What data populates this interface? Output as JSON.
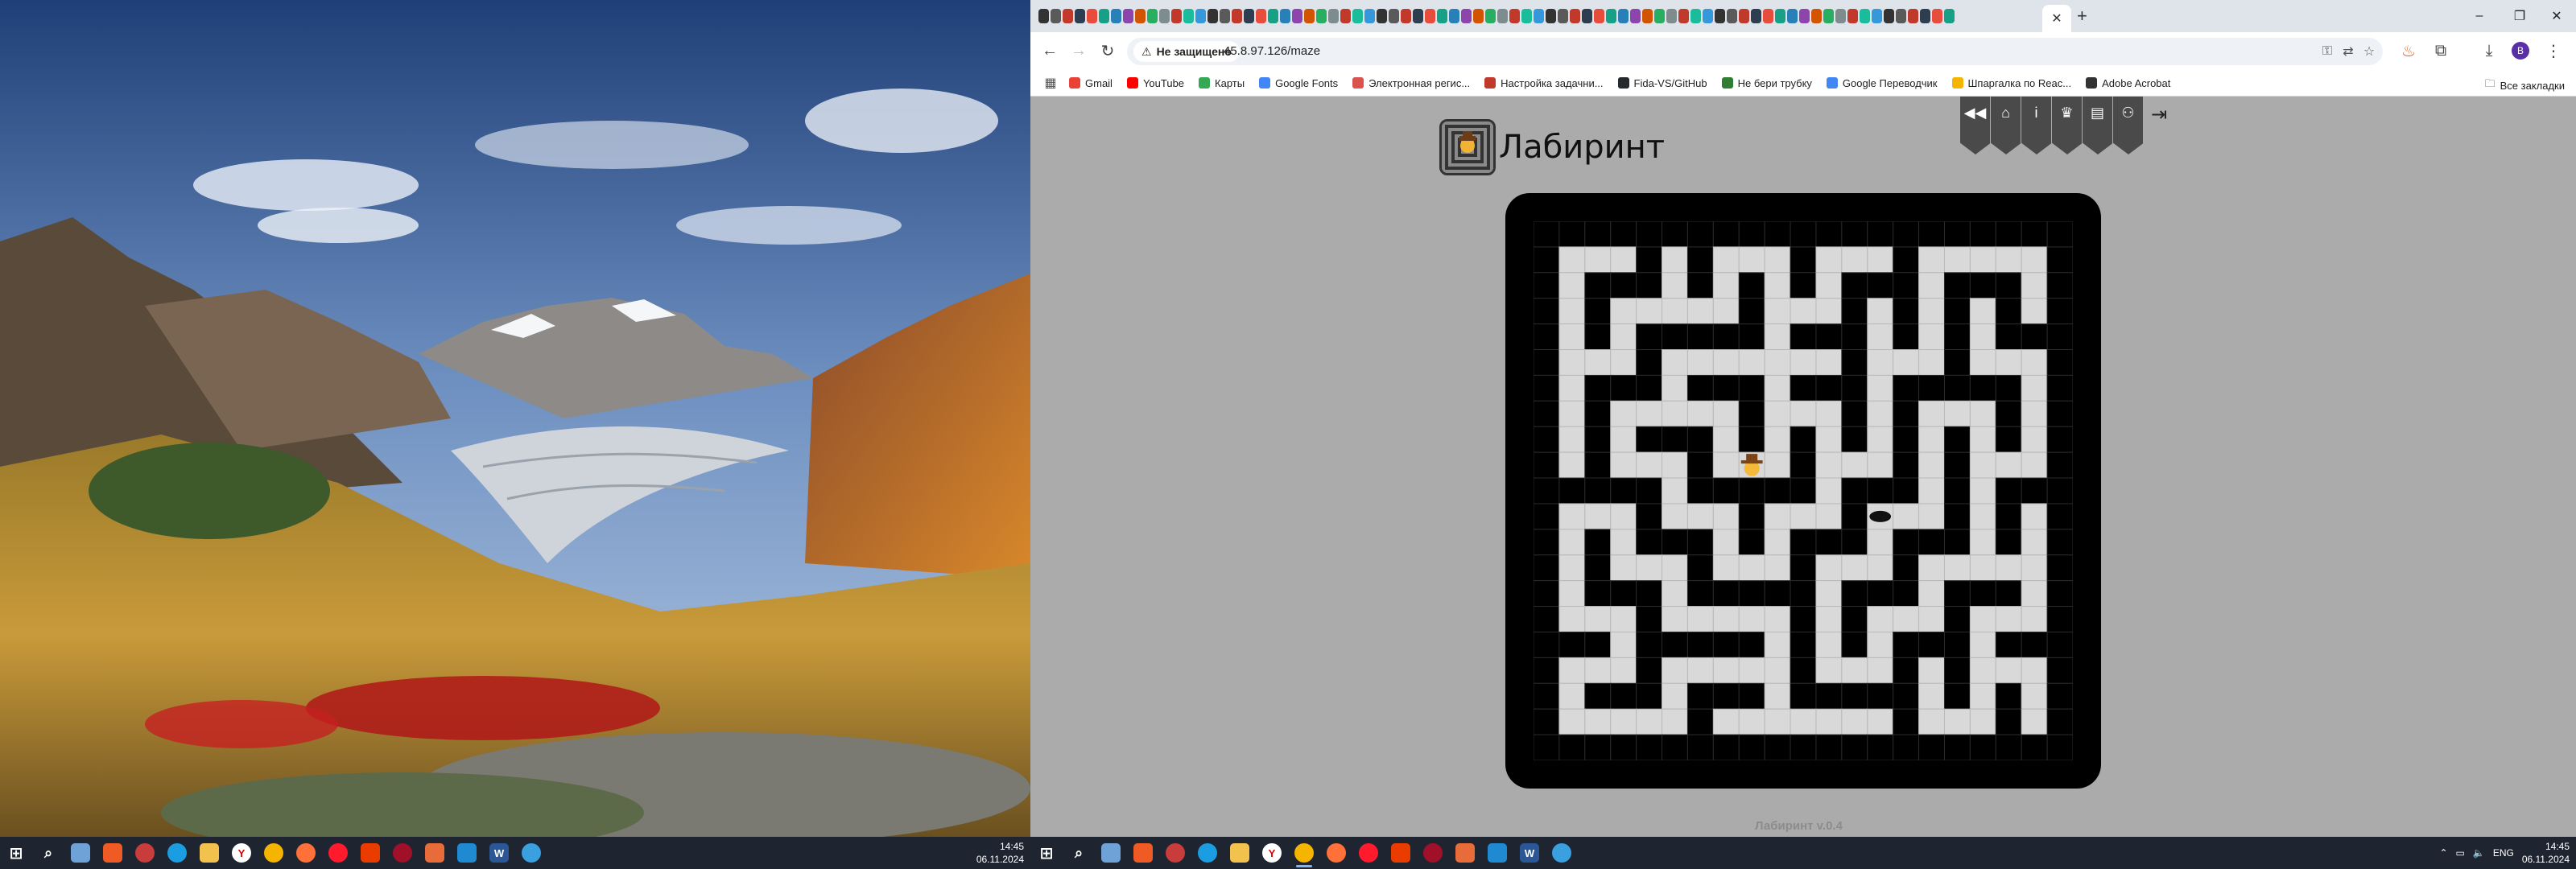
{
  "browser": {
    "url": "45.8.97.126/maze",
    "security_label": "Не защищено",
    "tab_close": "✕",
    "new_tab": "+",
    "window_controls": {
      "minimize": "–",
      "restore": "❐",
      "close": "✕"
    },
    "profile_initial": "B"
  },
  "bookmarks": [
    {
      "label": "Gmail",
      "color": "#ea4335"
    },
    {
      "label": "YouTube",
      "color": "#ff0000"
    },
    {
      "label": "Карты",
      "color": "#34a853"
    },
    {
      "label": "Google Fonts",
      "color": "#4285f4"
    },
    {
      "label": "Электронная регис...",
      "color": "#d9534f"
    },
    {
      "label": "Настройка задачни...",
      "color": "#c0392b"
    },
    {
      "label": "Fida-VS/GitHub",
      "color": "#24292e"
    },
    {
      "label": "Не бери трубку",
      "color": "#2e7d32"
    },
    {
      "label": "Google Переводчик",
      "color": "#4285f4"
    },
    {
      "label": "Шпаргалка по Reac...",
      "color": "#f4b400"
    },
    {
      "label": "Adobe Acrobat",
      "color": "#333333"
    }
  ],
  "bookmarks_all": "Все закладки",
  "app": {
    "title": "Лабиринт",
    "version": "Лабиринт v.0.4",
    "nav": [
      {
        "icon": "rewind-icon",
        "glyph": "◀◀"
      },
      {
        "icon": "home-icon",
        "glyph": "⌂"
      },
      {
        "icon": "info-icon",
        "glyph": "i"
      },
      {
        "icon": "trophy-icon",
        "glyph": "♛"
      },
      {
        "icon": "document-icon",
        "glyph": "▤"
      },
      {
        "icon": "users-icon",
        "glyph": "⚇"
      }
    ],
    "logout_glyph": "⇥"
  },
  "maze": {
    "cols": 21,
    "rows": 21,
    "rows_map": [
      "#####################",
      "#...#.#...#...#.....#",
      "#.###.#.#.#.###.###.#",
      "#.#.....#...#.#.#.#.#",
      "#.#.#####.###.#.#.###",
      "#...#.......#...#...#",
      "#.###.###.###.#####.#",
      "#.#.....#...#.#...#.#",
      "#.#.###.#.#.#.#.#.#.#",
      "#.#...#...#...#.#...#",
      "#####.#####.###.#.###",
      "#...#...#...#...#.#.#",
      "#.#.###.#.###.###.#.#",
      "#.#...#...#...#.....#",
      "#.###.#####.###.###.#",
      "#...#.....#.#...#...#",
      "###.#####.#.#.###.###",
      "#...#.....#...#.#...#",
      "#.###.###.#####.#.#.#",
      "#.....#.......#...#.#",
      "#####################"
    ],
    "player": {
      "col": 8,
      "row": 9
    },
    "hole": {
      "col": 13,
      "row": 11
    }
  },
  "taskbar_left": {
    "time": "14:45",
    "date": "06.11.2024"
  },
  "taskbar_right": {
    "time": "14:45",
    "date": "06.11.2024",
    "lang": "ENG"
  },
  "colors": {
    "page_bg": "#ababab",
    "maze_path": "#d9d9d9",
    "maze_wall": "#000000"
  }
}
